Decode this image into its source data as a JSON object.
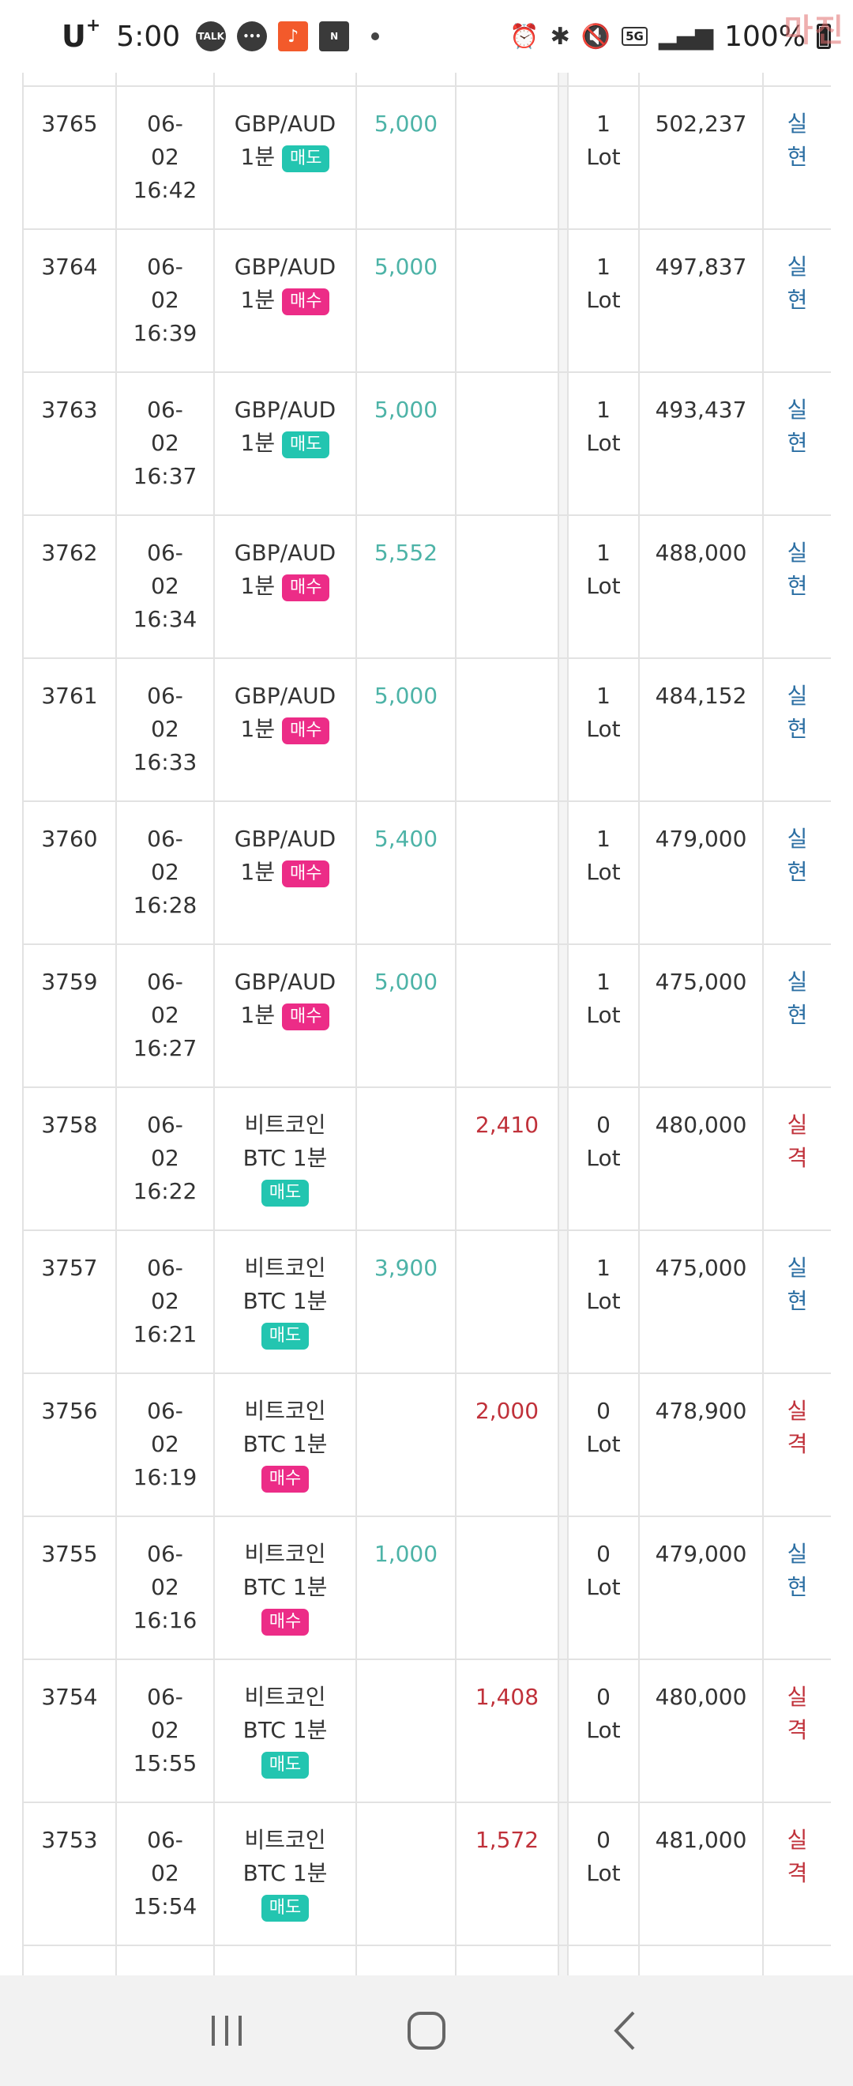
{
  "status_bar": {
    "carrier": "U",
    "carrier_sup": "+",
    "time": "5:00",
    "notif_talk": "TALK",
    "notif_n": "N",
    "battery": "100%",
    "net_badge": "5G",
    "watermark": "마진"
  },
  "rows": [
    {
      "id": "3765",
      "date": "06-",
      "day": "02",
      "time": "16:42",
      "sym1": "GBP/AUD",
      "sym2": "1분",
      "side": "매도",
      "side_type": "sell",
      "win": "5,000",
      "loss": "",
      "lot_n": "1",
      "lot_u": "Lot",
      "balance": "502,237",
      "res1": "실",
      "res2": "현",
      "res_type": "win"
    },
    {
      "id": "3764",
      "date": "06-",
      "day": "02",
      "time": "16:39",
      "sym1": "GBP/AUD",
      "sym2": "1분",
      "side": "매수",
      "side_type": "buy",
      "win": "5,000",
      "loss": "",
      "lot_n": "1",
      "lot_u": "Lot",
      "balance": "497,837",
      "res1": "실",
      "res2": "현",
      "res_type": "win"
    },
    {
      "id": "3763",
      "date": "06-",
      "day": "02",
      "time": "16:37",
      "sym1": "GBP/AUD",
      "sym2": "1분",
      "side": "매도",
      "side_type": "sell",
      "win": "5,000",
      "loss": "",
      "lot_n": "1",
      "lot_u": "Lot",
      "balance": "493,437",
      "res1": "실",
      "res2": "현",
      "res_type": "win"
    },
    {
      "id": "3762",
      "date": "06-",
      "day": "02",
      "time": "16:34",
      "sym1": "GBP/AUD",
      "sym2": "1분",
      "side": "매수",
      "side_type": "buy",
      "win": "5,552",
      "loss": "",
      "lot_n": "1",
      "lot_u": "Lot",
      "balance": "488,000",
      "res1": "실",
      "res2": "현",
      "res_type": "win"
    },
    {
      "id": "3761",
      "date": "06-",
      "day": "02",
      "time": "16:33",
      "sym1": "GBP/AUD",
      "sym2": "1분",
      "side": "매수",
      "side_type": "buy",
      "win": "5,000",
      "loss": "",
      "lot_n": "1",
      "lot_u": "Lot",
      "balance": "484,152",
      "res1": "실",
      "res2": "현",
      "res_type": "win"
    },
    {
      "id": "3760",
      "date": "06-",
      "day": "02",
      "time": "16:28",
      "sym1": "GBP/AUD",
      "sym2": "1분",
      "side": "매수",
      "side_type": "buy",
      "win": "5,400",
      "loss": "",
      "lot_n": "1",
      "lot_u": "Lot",
      "balance": "479,000",
      "res1": "실",
      "res2": "현",
      "res_type": "win"
    },
    {
      "id": "3759",
      "date": "06-",
      "day": "02",
      "time": "16:27",
      "sym1": "GBP/AUD",
      "sym2": "1분",
      "side": "매수",
      "side_type": "buy",
      "win": "5,000",
      "loss": "",
      "lot_n": "1",
      "lot_u": "Lot",
      "balance": "475,000",
      "res1": "실",
      "res2": "현",
      "res_type": "win"
    },
    {
      "id": "3758",
      "date": "06-",
      "day": "02",
      "time": "16:22",
      "sym1": "비트코인",
      "sym2": "BTC 1분",
      "side": "매도",
      "side_type": "sell",
      "win": "",
      "loss": "2,410",
      "lot_n": "0",
      "lot_u": "Lot",
      "balance": "480,000",
      "res1": "실",
      "res2": "격",
      "res_type": "loss"
    },
    {
      "id": "3757",
      "date": "06-",
      "day": "02",
      "time": "16:21",
      "sym1": "비트코인",
      "sym2": "BTC 1분",
      "side": "매도",
      "side_type": "sell",
      "win": "3,900",
      "loss": "",
      "lot_n": "1",
      "lot_u": "Lot",
      "balance": "475,000",
      "res1": "실",
      "res2": "현",
      "res_type": "win"
    },
    {
      "id": "3756",
      "date": "06-",
      "day": "02",
      "time": "16:19",
      "sym1": "비트코인",
      "sym2": "BTC 1분",
      "side": "매수",
      "side_type": "buy",
      "win": "",
      "loss": "2,000",
      "lot_n": "0",
      "lot_u": "Lot",
      "balance": "478,900",
      "res1": "실",
      "res2": "격",
      "res_type": "loss"
    },
    {
      "id": "3755",
      "date": "06-",
      "day": "02",
      "time": "16:16",
      "sym1": "비트코인",
      "sym2": "BTC 1분",
      "side": "매수",
      "side_type": "buy",
      "win": "1,000",
      "loss": "",
      "lot_n": "0",
      "lot_u": "Lot",
      "balance": "479,000",
      "res1": "실",
      "res2": "현",
      "res_type": "win"
    },
    {
      "id": "3754",
      "date": "06-",
      "day": "02",
      "time": "15:55",
      "sym1": "비트코인",
      "sym2": "BTC 1분",
      "side": "매도",
      "side_type": "sell",
      "win": "",
      "loss": "1,408",
      "lot_n": "0",
      "lot_u": "Lot",
      "balance": "480,000",
      "res1": "실",
      "res2": "격",
      "res_type": "loss"
    },
    {
      "id": "3753",
      "date": "06-",
      "day": "02",
      "time": "15:54",
      "sym1": "비트코인",
      "sym2": "BTC 1분",
      "side": "매도",
      "side_type": "sell",
      "win": "",
      "loss": "1,572",
      "lot_n": "0",
      "lot_u": "Lot",
      "balance": "481,000",
      "res1": "실",
      "res2": "격",
      "res_type": "loss"
    }
  ]
}
